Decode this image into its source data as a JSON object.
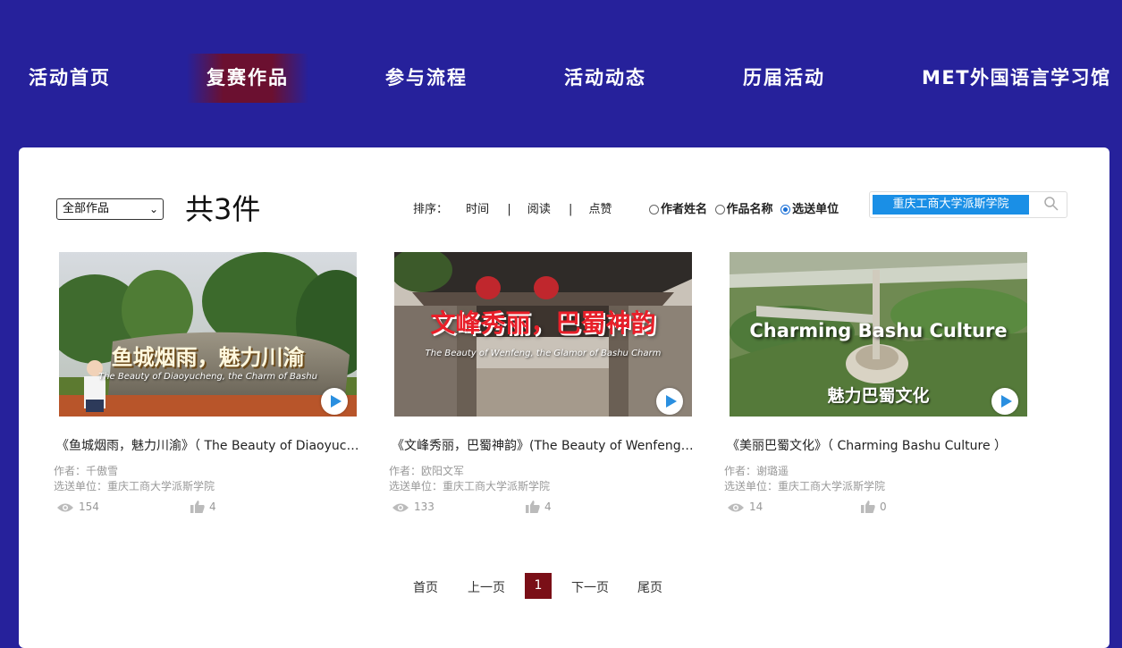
{
  "nav": {
    "items": [
      {
        "label": "活动首页"
      },
      {
        "label": "复赛作品"
      },
      {
        "label": "参与流程"
      },
      {
        "label": "活动动态"
      },
      {
        "label": "历届活动"
      },
      {
        "label": "MET外国语言学习馆"
      }
    ],
    "active": "复赛作品"
  },
  "toolbar": {
    "filter_value": "全部作品",
    "total_label": "共3件",
    "sort_label": "排序：",
    "sort_options": [
      "时间",
      "阅读",
      "点赞"
    ],
    "sort_separator": "|",
    "search_fields": [
      {
        "label": "作者姓名",
        "checked": false
      },
      {
        "label": "作品名称",
        "checked": false
      },
      {
        "label": "选送单位",
        "checked": true
      }
    ],
    "search_value": "重庆工商大学派斯学院",
    "search_icon": "search-icon"
  },
  "works": [
    {
      "thumb_title": "鱼城烟雨，魅力川渝",
      "thumb_subtitle": "The Beauty of Diaoyucheng, the Charm of Bashu",
      "title": "《鱼城烟雨，魅力川渝》（ The Beauty of Diaoyucheng, the Charm of Bashu）",
      "author": "作者：千傲雪",
      "unit": "选送单位：重庆工商大学派斯学院",
      "views": "154",
      "likes": "4"
    },
    {
      "thumb_title": "文峰秀丽，巴蜀神韵",
      "thumb_subtitle": "The Beauty of Wenfeng, the Glamor of Bashu Charm",
      "title": "《文峰秀丽，巴蜀神韵》(The Beauty of Wenfeng, the Glamor of Bashu Charm)",
      "author": "作者：欧阳文军",
      "unit": "选送单位：重庆工商大学派斯学院",
      "views": "133",
      "likes": "4"
    },
    {
      "thumb_title": "Charming Bashu Culture",
      "thumb_subtitle": "魅力巴蜀文化",
      "title": "《美丽巴蜀文化》（ Charming Bashu Culture ）",
      "author": "作者：谢璐遥",
      "unit": "选送单位：重庆工商大学派斯学院",
      "views": "14",
      "likes": "0"
    }
  ],
  "pagination": {
    "first": "首页",
    "prev": "上一页",
    "current": "1",
    "next": "下一页",
    "last": "尾页"
  },
  "colors": {
    "background": "#26219b",
    "active_nav": "#6b1030",
    "search_fill": "#1a8fe6",
    "current_page": "#7a0f17"
  }
}
